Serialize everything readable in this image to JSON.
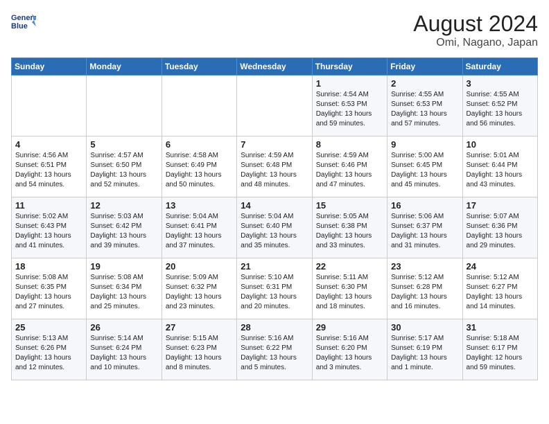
{
  "header": {
    "logo_line1": "General",
    "logo_line2": "Blue",
    "month_year": "August 2024",
    "location": "Omi, Nagano, Japan"
  },
  "days_of_week": [
    "Sunday",
    "Monday",
    "Tuesday",
    "Wednesday",
    "Thursday",
    "Friday",
    "Saturday"
  ],
  "weeks": [
    [
      {
        "day": "",
        "content": ""
      },
      {
        "day": "",
        "content": ""
      },
      {
        "day": "",
        "content": ""
      },
      {
        "day": "",
        "content": ""
      },
      {
        "day": "1",
        "content": "Sunrise: 4:54 AM\nSunset: 6:53 PM\nDaylight: 13 hours\nand 59 minutes."
      },
      {
        "day": "2",
        "content": "Sunrise: 4:55 AM\nSunset: 6:53 PM\nDaylight: 13 hours\nand 57 minutes."
      },
      {
        "day": "3",
        "content": "Sunrise: 4:55 AM\nSunset: 6:52 PM\nDaylight: 13 hours\nand 56 minutes."
      }
    ],
    [
      {
        "day": "4",
        "content": "Sunrise: 4:56 AM\nSunset: 6:51 PM\nDaylight: 13 hours\nand 54 minutes."
      },
      {
        "day": "5",
        "content": "Sunrise: 4:57 AM\nSunset: 6:50 PM\nDaylight: 13 hours\nand 52 minutes."
      },
      {
        "day": "6",
        "content": "Sunrise: 4:58 AM\nSunset: 6:49 PM\nDaylight: 13 hours\nand 50 minutes."
      },
      {
        "day": "7",
        "content": "Sunrise: 4:59 AM\nSunset: 6:48 PM\nDaylight: 13 hours\nand 48 minutes."
      },
      {
        "day": "8",
        "content": "Sunrise: 4:59 AM\nSunset: 6:46 PM\nDaylight: 13 hours\nand 47 minutes."
      },
      {
        "day": "9",
        "content": "Sunrise: 5:00 AM\nSunset: 6:45 PM\nDaylight: 13 hours\nand 45 minutes."
      },
      {
        "day": "10",
        "content": "Sunrise: 5:01 AM\nSunset: 6:44 PM\nDaylight: 13 hours\nand 43 minutes."
      }
    ],
    [
      {
        "day": "11",
        "content": "Sunrise: 5:02 AM\nSunset: 6:43 PM\nDaylight: 13 hours\nand 41 minutes."
      },
      {
        "day": "12",
        "content": "Sunrise: 5:03 AM\nSunset: 6:42 PM\nDaylight: 13 hours\nand 39 minutes."
      },
      {
        "day": "13",
        "content": "Sunrise: 5:04 AM\nSunset: 6:41 PM\nDaylight: 13 hours\nand 37 minutes."
      },
      {
        "day": "14",
        "content": "Sunrise: 5:04 AM\nSunset: 6:40 PM\nDaylight: 13 hours\nand 35 minutes."
      },
      {
        "day": "15",
        "content": "Sunrise: 5:05 AM\nSunset: 6:38 PM\nDaylight: 13 hours\nand 33 minutes."
      },
      {
        "day": "16",
        "content": "Sunrise: 5:06 AM\nSunset: 6:37 PM\nDaylight: 13 hours\nand 31 minutes."
      },
      {
        "day": "17",
        "content": "Sunrise: 5:07 AM\nSunset: 6:36 PM\nDaylight: 13 hours\nand 29 minutes."
      }
    ],
    [
      {
        "day": "18",
        "content": "Sunrise: 5:08 AM\nSunset: 6:35 PM\nDaylight: 13 hours\nand 27 minutes."
      },
      {
        "day": "19",
        "content": "Sunrise: 5:08 AM\nSunset: 6:34 PM\nDaylight: 13 hours\nand 25 minutes."
      },
      {
        "day": "20",
        "content": "Sunrise: 5:09 AM\nSunset: 6:32 PM\nDaylight: 13 hours\nand 23 minutes."
      },
      {
        "day": "21",
        "content": "Sunrise: 5:10 AM\nSunset: 6:31 PM\nDaylight: 13 hours\nand 20 minutes."
      },
      {
        "day": "22",
        "content": "Sunrise: 5:11 AM\nSunset: 6:30 PM\nDaylight: 13 hours\nand 18 minutes."
      },
      {
        "day": "23",
        "content": "Sunrise: 5:12 AM\nSunset: 6:28 PM\nDaylight: 13 hours\nand 16 minutes."
      },
      {
        "day": "24",
        "content": "Sunrise: 5:12 AM\nSunset: 6:27 PM\nDaylight: 13 hours\nand 14 minutes."
      }
    ],
    [
      {
        "day": "25",
        "content": "Sunrise: 5:13 AM\nSunset: 6:26 PM\nDaylight: 13 hours\nand 12 minutes."
      },
      {
        "day": "26",
        "content": "Sunrise: 5:14 AM\nSunset: 6:24 PM\nDaylight: 13 hours\nand 10 minutes."
      },
      {
        "day": "27",
        "content": "Sunrise: 5:15 AM\nSunset: 6:23 PM\nDaylight: 13 hours\nand 8 minutes."
      },
      {
        "day": "28",
        "content": "Sunrise: 5:16 AM\nSunset: 6:22 PM\nDaylight: 13 hours\nand 5 minutes."
      },
      {
        "day": "29",
        "content": "Sunrise: 5:16 AM\nSunset: 6:20 PM\nDaylight: 13 hours\nand 3 minutes."
      },
      {
        "day": "30",
        "content": "Sunrise: 5:17 AM\nSunset: 6:19 PM\nDaylight: 13 hours\nand 1 minute."
      },
      {
        "day": "31",
        "content": "Sunrise: 5:18 AM\nSunset: 6:17 PM\nDaylight: 12 hours\nand 59 minutes."
      }
    ]
  ]
}
